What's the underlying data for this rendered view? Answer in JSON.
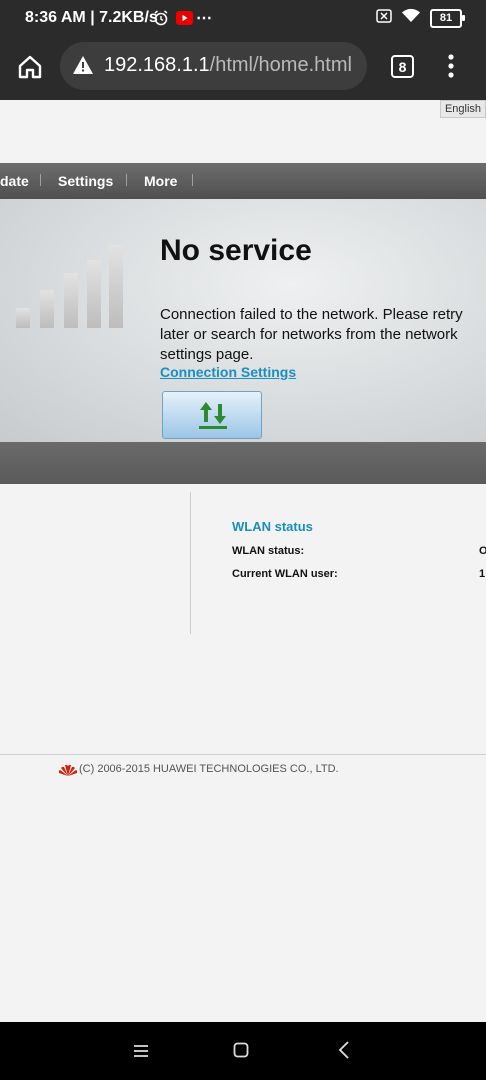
{
  "status_bar": {
    "time": "8:36 AM | 7.2KB/s",
    "battery": "81"
  },
  "browser": {
    "url_host": "192.168.1.1",
    "url_path": "/html/home.html",
    "tab_count": "8"
  },
  "page": {
    "language": "English",
    "nav": {
      "partial_item": "date",
      "settings": "Settings",
      "more": "More"
    },
    "banner": {
      "title": "No service",
      "message": "Connection failed to the network. Please retry later or search for networks from the network settings page.",
      "link": "Connection Settings"
    },
    "wlan": {
      "title": "WLAN status",
      "rows": [
        {
          "label": "WLAN status:",
          "value": "O"
        },
        {
          "label": "Current WLAN user:",
          "value": "1"
        }
      ]
    },
    "footer": "(C) 2006-2015 HUAWEI TECHNOLOGIES CO., LTD."
  }
}
